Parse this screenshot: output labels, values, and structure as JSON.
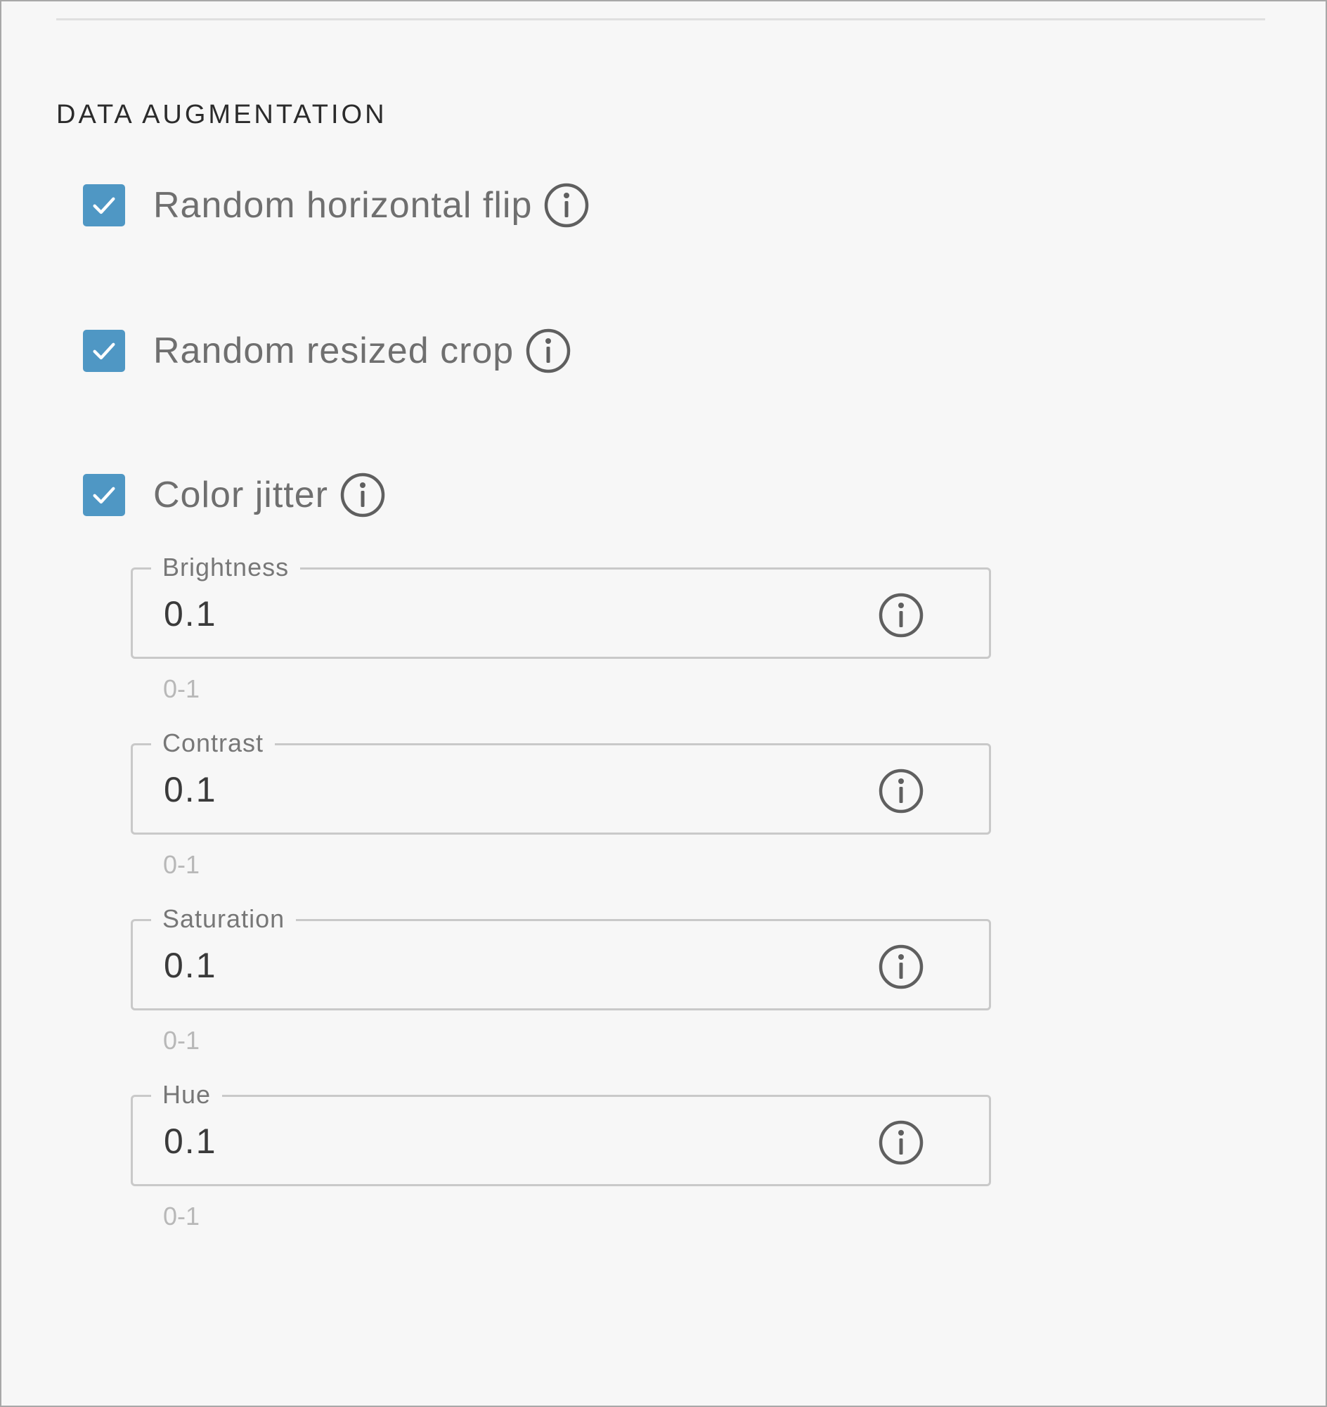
{
  "section": {
    "title": "DATA AUGMENTATION"
  },
  "options": [
    {
      "label": "Random horizontal flip",
      "checked": true,
      "icon": "info-icon"
    },
    {
      "label": "Random resized crop",
      "checked": true,
      "icon": "info-icon"
    },
    {
      "label": "Color jitter",
      "checked": true,
      "icon": "info-icon"
    }
  ],
  "color_jitter": {
    "fields": [
      {
        "label": "Brightness",
        "value": "0.1",
        "hint": "0-1",
        "icon": "info-icon"
      },
      {
        "label": "Contrast",
        "value": "0.1",
        "hint": "0-1",
        "icon": "info-icon"
      },
      {
        "label": "Saturation",
        "value": "0.1",
        "hint": "0-1",
        "icon": "info-icon"
      },
      {
        "label": "Hue",
        "value": "0.1",
        "hint": "0-1",
        "icon": "info-icon"
      }
    ]
  },
  "colors": {
    "checkbox": "#4f97c4",
    "background": "#f7f7f7",
    "border": "#c9c9c9"
  }
}
